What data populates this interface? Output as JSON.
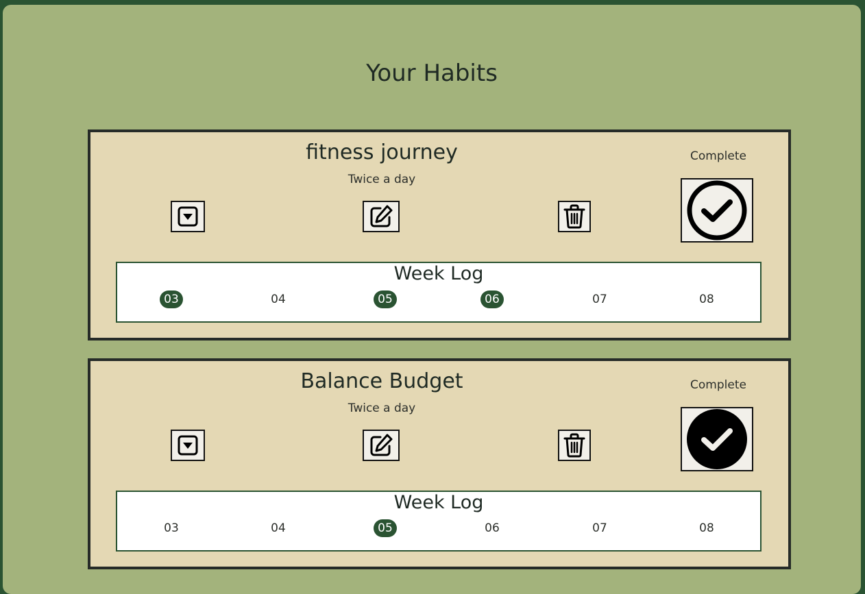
{
  "page": {
    "title": "Your Habits"
  },
  "colors": {
    "accent": "#2a5332",
    "background": "#a3b37c",
    "card": "#e4d8b4"
  },
  "habits": [
    {
      "name": "fitness journey",
      "frequency": "Twice a day",
      "complete_label": "Complete",
      "completed": false,
      "icons": {
        "expand": "caret-down-square-icon",
        "edit": "edit-icon",
        "delete": "trash-icon",
        "complete": "check-circle-outline-icon"
      },
      "week_log": {
        "title": "Week Log",
        "days": [
          {
            "label": "03",
            "done": true
          },
          {
            "label": "04",
            "done": false
          },
          {
            "label": "05",
            "done": true
          },
          {
            "label": "06",
            "done": true
          },
          {
            "label": "07",
            "done": false
          },
          {
            "label": "08",
            "done": false
          }
        ]
      }
    },
    {
      "name": "Balance Budget",
      "frequency": "Twice a day",
      "complete_label": "Complete",
      "completed": true,
      "icons": {
        "expand": "caret-down-square-icon",
        "edit": "edit-icon",
        "delete": "trash-icon",
        "complete": "check-circle-filled-icon"
      },
      "week_log": {
        "title": "Week Log",
        "days": [
          {
            "label": "03",
            "done": false
          },
          {
            "label": "04",
            "done": false
          },
          {
            "label": "05",
            "done": true
          },
          {
            "label": "06",
            "done": false
          },
          {
            "label": "07",
            "done": false
          },
          {
            "label": "08",
            "done": false
          }
        ]
      }
    }
  ]
}
